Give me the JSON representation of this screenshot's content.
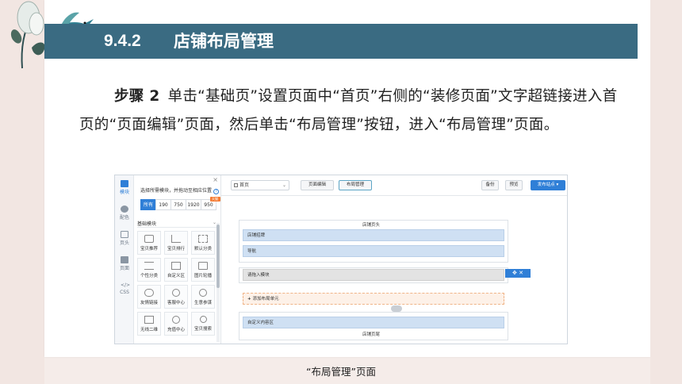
{
  "slide": {
    "section_number": "9.4.2",
    "section_title": "店铺布局管理",
    "step_label": "步骤 2",
    "step_text": "单击“基础页”设置页面中“首页”右侧的“装修页面”文字超链接进入首页的“页面编辑”页面，然后单击“布局管理”按钮，进入“布局管理”页面。",
    "caption": "“布局管理”页面"
  },
  "colors": {
    "heading_bar": "#3a6b82",
    "accent_blue": "#2f7fd7",
    "badge_orange": "#f57b34"
  },
  "editor": {
    "rail": [
      {
        "label": "模块",
        "icon": "grid-icon",
        "active": true
      },
      {
        "label": "配色",
        "icon": "palette-icon",
        "active": false
      },
      {
        "label": "页头",
        "icon": "header-icon",
        "active": false
      },
      {
        "label": "页面",
        "icon": "page-icon",
        "active": false
      },
      {
        "label": "CSS",
        "icon": "code-icon",
        "active": false
      }
    ],
    "module_panel": {
      "close": "×",
      "hint": "选择所需模块，并拖动至相应位置",
      "size_tabs": [
        "所有",
        "190",
        "750",
        "1920",
        "950"
      ],
      "size_badge": "天猫专用",
      "group_title": "基础模块",
      "modules": [
        {
          "label": "宝贝推荐",
          "icon": "recommend-icon"
        },
        {
          "label": "宝贝排行",
          "icon": "ranking-icon"
        },
        {
          "label": "默认分类",
          "icon": "category-icon"
        },
        {
          "label": "个性分类",
          "icon": "custom-category-icon"
        },
        {
          "label": "自定义区",
          "icon": "custom-area-icon"
        },
        {
          "label": "图片轮播",
          "icon": "carousel-icon"
        },
        {
          "label": "友情链接",
          "icon": "link-icon"
        },
        {
          "label": "客服中心",
          "icon": "service-icon"
        },
        {
          "label": "生意参谋",
          "icon": "compass-icon"
        },
        {
          "label": "无线二维",
          "icon": "qrcode-icon"
        },
        {
          "label": "充值中心",
          "icon": "recharge-icon"
        },
        {
          "label": "宝贝搜索",
          "icon": "search-icon"
        }
      ]
    },
    "toolbar": {
      "page_select": "首页",
      "page_edit": "页面编辑",
      "layout_manage": "布局管理",
      "backup": "备份",
      "preview": "预览",
      "publish": "发布站点"
    },
    "canvas": {
      "header_title": "店铺页头",
      "shop_recruit": "店铺招牌",
      "nav": "导航",
      "drop_module": "请拖入模块",
      "add_layout_unit": "添加布局单元",
      "custom_area": "自定义内容区",
      "footer_title": "店铺页尾"
    }
  }
}
